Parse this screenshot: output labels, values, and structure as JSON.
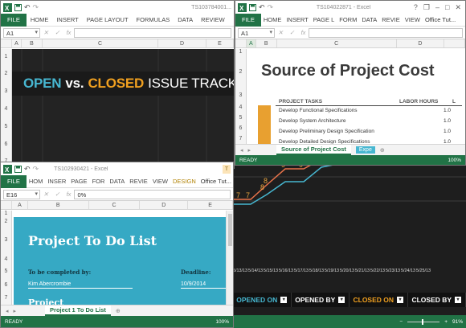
{
  "win1": {
    "title": "TS103784001...",
    "tabs": [
      "FILE",
      "HOME",
      "INSERT",
      "PAGE LAYOUT",
      "FORMULAS",
      "DATA",
      "REVIEW"
    ],
    "namebox": "A1",
    "columns": [
      "A",
      "B",
      "C",
      "D",
      "E"
    ],
    "rows": [
      "1",
      "2",
      "3",
      "4",
      "5",
      "6",
      "7"
    ],
    "banner": {
      "open": "OPEN",
      "vs": "vs.",
      "closed": "CLOSED",
      "rest": "ISSUE TRACKER"
    }
  },
  "win2": {
    "title": "TS104022871 - Excel",
    "tabs": [
      "FILE",
      "HOME",
      "INSERT",
      "PAGE L",
      "FORM",
      "DATA",
      "REVIE",
      "VIEW"
    ],
    "account": "Office Tut...",
    "namebox": "A1",
    "columns": [
      "A",
      "B",
      "C",
      "D"
    ],
    "rows": [
      "1",
      "2",
      "3",
      "4",
      "5",
      "6",
      "7"
    ],
    "heading": "Source of Project Cost",
    "header_tasks": "PROJECT TASKS",
    "header_hours": "LABOR HOURS",
    "header_l": "L",
    "tasks": [
      {
        "name": "Develop Functional Specifications",
        "hours": "1.0"
      },
      {
        "name": "Develop System Architecture",
        "hours": "1.0"
      },
      {
        "name": "Develop Preliminary Design Specification",
        "hours": "1.0"
      },
      {
        "name": "Develop Detailed Design Specifications",
        "hours": "1.0"
      }
    ],
    "sheet_tab": "Source of Project Cost",
    "sheet_tab2": "Expe",
    "status": "READY",
    "zoom": "100%"
  },
  "win3": {
    "title": "TS102930421 - Excel",
    "design_tab": "DESIGN",
    "tabs": [
      "FILE",
      "HOM",
      "INSER",
      "PAGE",
      "FOR",
      "DATA",
      "REVIE",
      "VIEW"
    ],
    "account": "Office Tut...",
    "namebox": "E16",
    "formula": "0%",
    "columns": [
      "A",
      "B",
      "C",
      "D",
      "E"
    ],
    "rows": [
      "1",
      "2",
      "3",
      "4",
      "5",
      "6",
      "7"
    ],
    "title_text": "Project To Do List",
    "completed_by_label": "To be completed by:",
    "completed_by": "Kim Abercrombie",
    "deadline_label": "Deadline:",
    "deadline": "10/9/2014",
    "cut_text": "Project",
    "sheet_tab": "Project 1 To Do List",
    "status": "READY",
    "zoom": "100%"
  },
  "backdrop": {
    "dates": [
      "5/13/13",
      "5/14/13",
      "5/15/13",
      "5/16/13",
      "5/17/13",
      "5/18/13",
      "5/19/13",
      "5/20/13",
      "5/21/13",
      "5/22/13",
      "5/23/13",
      "5/24/13",
      "5/25/13"
    ],
    "point_labels": [
      {
        "text": "7",
        "color": "#e8a33d"
      },
      {
        "text": "8",
        "color": "#e8a33d"
      },
      {
        "text": "9",
        "color": "#e8a33d"
      },
      {
        "text": "9",
        "color": "#e8a33d"
      },
      {
        "text": "7",
        "color": "#e8a33d"
      },
      {
        "text": "8",
        "color": "#e8a33d"
      }
    ],
    "headers": [
      {
        "text": "OPENED ON",
        "color": "#47b7d1"
      },
      {
        "text": "OPENED BY",
        "color": "#ffffff"
      },
      {
        "text": "CLOSED ON",
        "color": "#f0a020"
      },
      {
        "text": "CLOSED BY",
        "color": "#ffffff"
      }
    ],
    "status_zoom": "91%"
  },
  "colors": {
    "excel_green": "#217346",
    "teal": "#36a9c4",
    "orange": "#e8a030",
    "dark": "#222222"
  }
}
